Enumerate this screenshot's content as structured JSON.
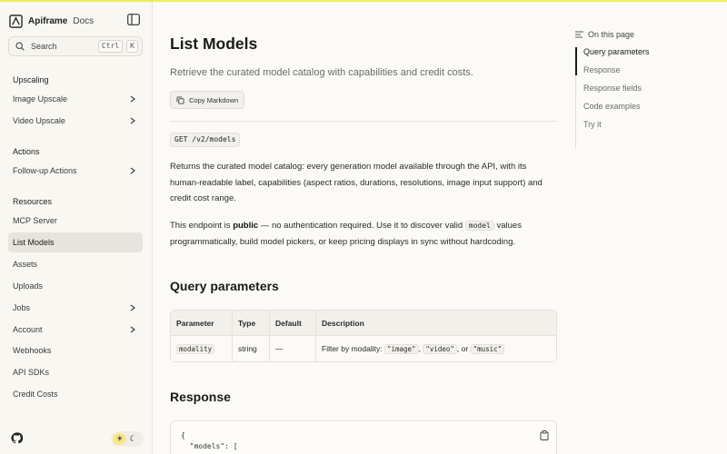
{
  "brand": {
    "name": "Apiframe",
    "section": "Docs"
  },
  "search": {
    "label": "Search",
    "shortcut": [
      "Ctrl",
      "K"
    ]
  },
  "sidebar": {
    "groups": [
      {
        "title": "Upscaling",
        "items": [
          {
            "label": "Image Upscale",
            "expandable": true
          },
          {
            "label": "Video Upscale",
            "expandable": true
          }
        ]
      },
      {
        "title": "Actions",
        "items": [
          {
            "label": "Follow-up Actions",
            "expandable": true
          }
        ]
      },
      {
        "title": "Resources",
        "items": [
          {
            "label": "MCP Server"
          },
          {
            "label": "List Models",
            "active": true
          },
          {
            "label": "Assets"
          },
          {
            "label": "Uploads"
          },
          {
            "label": "Jobs",
            "expandable": true
          },
          {
            "label": "Account",
            "expandable": true
          },
          {
            "label": "Webhooks"
          },
          {
            "label": "API SDKs"
          },
          {
            "label": "Credit Costs"
          }
        ]
      }
    ],
    "theme": {
      "selected": "light"
    }
  },
  "page": {
    "title": "List Models",
    "description": "Retrieve the curated model catalog with capabilities and credit costs.",
    "copy_label": "Copy Markdown",
    "endpoint": "GET /v2/models",
    "para1": "Returns the curated model catalog: every generation model available through the API, with its human-readable label, capabilities (aspect ratios, durations, resolutions, image input support) and credit cost range.",
    "para2": {
      "pre": "This endpoint is ",
      "bold": "public",
      "mid": " — no authentication required. Use it to discover valid ",
      "code": "model",
      "post": " values programmatically, build model pickers, or keep pricing displays in sync without hardcoding."
    },
    "query_heading": "Query parameters",
    "table": {
      "headers": [
        "Parameter",
        "Type",
        "Default",
        "Description"
      ],
      "row": {
        "parameter": "modality",
        "type": "string",
        "default": "—",
        "desc_pre": "Filter by modality: ",
        "values": [
          "\"image\"",
          "\"video\"",
          "\"music\""
        ],
        "sep1": ", ",
        "sep2": ", or "
      }
    },
    "response_heading": "Response",
    "code_lines": [
      "{",
      "  \"models\": [",
      "    {"
    ]
  },
  "toc": {
    "title": "On this page",
    "items": [
      "Query parameters",
      "Response",
      "Response fields",
      "Code examples",
      "Try it"
    ],
    "active_index": 0
  },
  "colors": {
    "accent_bar": "#f0ec5a",
    "active_nav_bg": "#e6e4dd"
  }
}
